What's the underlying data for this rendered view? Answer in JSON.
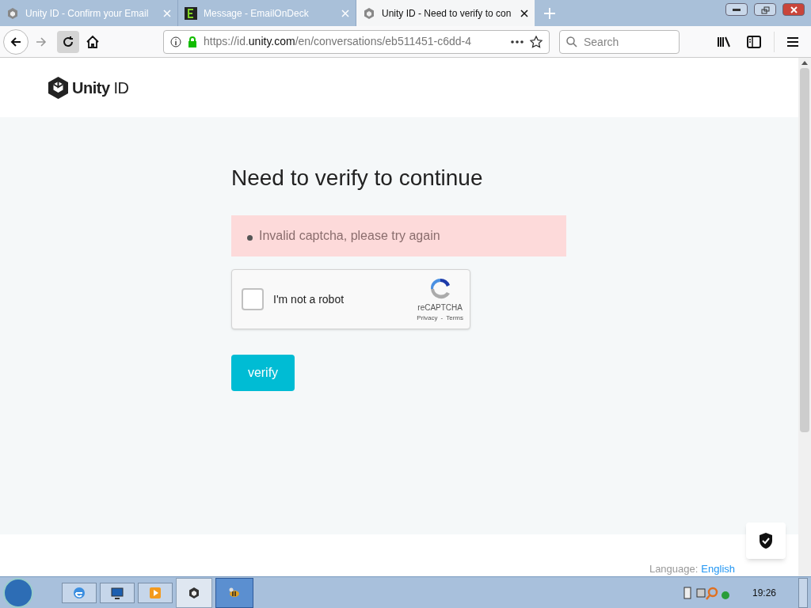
{
  "tabs": [
    {
      "title": "Unity ID - Confirm your Email",
      "selected": false
    },
    {
      "title": "Message - EmailOnDeck",
      "selected": false
    },
    {
      "title": "Unity ID - Need to verify to con",
      "selected": true
    }
  ],
  "address": {
    "prefix": "https://id.",
    "domain": "unity.com",
    "path": "/en/conversations/eb511451-c6dd-4"
  },
  "search": {
    "placeholder": "Search"
  },
  "page": {
    "brand": "Unity ID",
    "heading": "Need to verify to continue",
    "error": "Invalid captcha, please try again",
    "captcha": {
      "label": "I'm not a robot",
      "checked": false,
      "brand": "reCAPTCHA",
      "privacy": "Privacy",
      "separator": "-",
      "terms": "Terms"
    },
    "button": "verify",
    "footer": {
      "label": "Language:",
      "value": "English"
    }
  },
  "taskbar": {
    "apps": [
      {
        "selected": false
      },
      {
        "selected": false
      },
      {
        "selected": false
      },
      {
        "selected": false
      },
      {
        "selected": true
      }
    ],
    "clock": "19:26"
  }
}
